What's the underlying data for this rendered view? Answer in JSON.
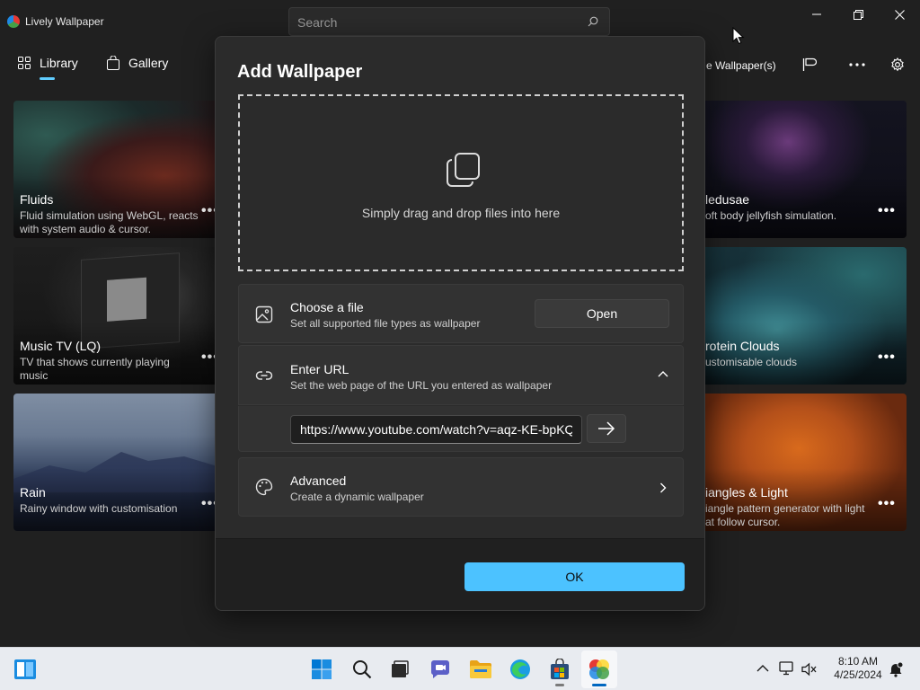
{
  "app": {
    "title": "Lively Wallpaper"
  },
  "search": {
    "placeholder": "Search"
  },
  "nav": {
    "library": "Library",
    "gallery": "Gallery",
    "manage_partial": "e Wallpaper(s)"
  },
  "cards": [
    {
      "title": "Fluids",
      "desc_line1": "Fluid simulation using WebGL, reacts",
      "desc_line2": "with system audio & cursor.",
      "more": "•••"
    },
    {
      "title": "Music TV (LQ)",
      "desc_line1": "TV that shows currently playing",
      "desc_line2": "music",
      "more": "•••"
    },
    {
      "title": "Rain",
      "desc_line1": "Rainy window with customisation",
      "desc_line2": "",
      "more": "•••"
    },
    {
      "title": "ledusae",
      "desc_line1": "oft body jellyfish simulation.",
      "desc_line2": "",
      "more": "•••"
    },
    {
      "title": "rotein Clouds",
      "desc_line1": "ustomisable clouds",
      "desc_line2": "",
      "more": "•••"
    },
    {
      "title": "iangles & Light",
      "desc_line1": "iangle pattern generator with light",
      "desc_line2": "at follow cursor.",
      "more": "•••"
    }
  ],
  "dialog": {
    "title": "Add Wallpaper",
    "drop_text": "Simply drag and drop files into here",
    "choose_file": {
      "title": "Choose a file",
      "subtitle": "Set all supported file types as wallpaper",
      "button": "Open"
    },
    "enter_url": {
      "title": "Enter URL",
      "subtitle": "Set the web page of the URL you entered as wallpaper",
      "value": "https://www.youtube.com/watch?v=aqz-KE-bpKQ"
    },
    "advanced": {
      "title": "Advanced",
      "subtitle": "Create a dynamic wallpaper"
    },
    "ok": "OK"
  },
  "taskbar": {
    "time": "8:10 AM",
    "date": "4/25/2024"
  },
  "colors": {
    "accent": "#4cc2ff",
    "nav_indicator": "#60cdff",
    "background": "#202020",
    "dialog": "#2b2b2b"
  }
}
